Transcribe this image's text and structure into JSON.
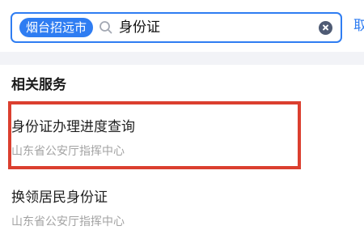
{
  "search": {
    "city": "烟台招远市",
    "query": "身份证",
    "cancel_label": "取消"
  },
  "section": {
    "title": "相关服务"
  },
  "services": [
    {
      "title": "身份证办理进度查询",
      "provider": "山东省公安厅指挥中心"
    },
    {
      "title": "换领居民身份证",
      "provider": "山东省公安厅指挥中心"
    }
  ],
  "colors": {
    "accent": "#2f7df2",
    "highlight": "#db3f2f",
    "divider": "#f2f3f7",
    "muted_text": "#a3a3a3"
  }
}
